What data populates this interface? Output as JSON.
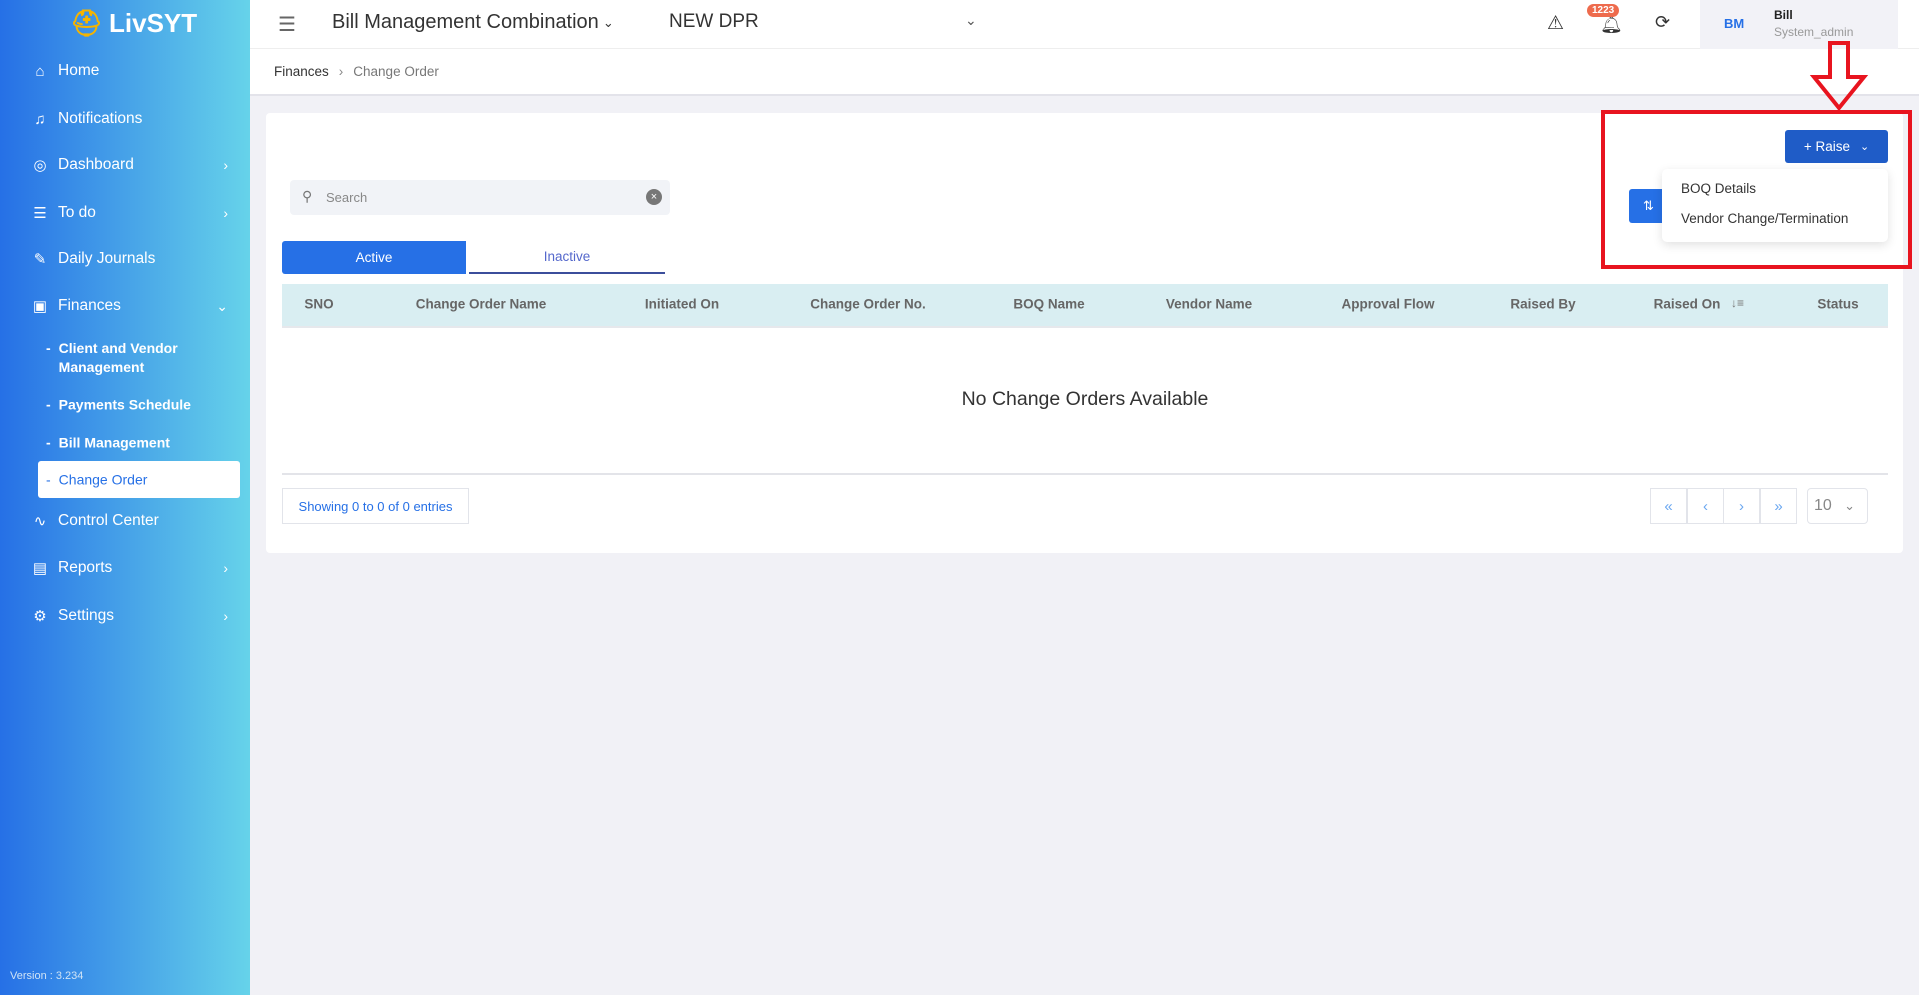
{
  "app": {
    "logo": "LivSYT",
    "version": "Version : 3.234"
  },
  "sidebar": {
    "items": [
      {
        "label": "Home",
        "icon": "home-icon",
        "glyph": "⌂"
      },
      {
        "label": "Notifications",
        "icon": "bell-icon",
        "glyph": "🔔"
      },
      {
        "label": "Dashboard",
        "icon": "gauge-icon",
        "glyph": "◎"
      },
      {
        "label": "To do",
        "icon": "list-icon",
        "glyph": "☰"
      },
      {
        "label": "Daily Journals",
        "icon": "pencil-icon",
        "glyph": "✎"
      },
      {
        "label": "Finances",
        "icon": "money-icon",
        "glyph": "▣"
      },
      {
        "label": "Control Center",
        "icon": "pulse-icon",
        "glyph": "∿"
      },
      {
        "label": "Reports",
        "icon": "report-icon",
        "glyph": "▤"
      },
      {
        "label": "Settings",
        "icon": "gear-icon",
        "glyph": "⚙"
      }
    ],
    "finances_sub": [
      "Client and Vendor Management",
      "Payments Schedule",
      "Bill Management",
      "Change Order"
    ]
  },
  "header": {
    "project": "Bill Management Combination",
    "dpr": "NEW DPR",
    "notification_count": "1223",
    "user_initials": "BM",
    "user_name": "Bill",
    "user_role": "System_admin"
  },
  "breadcrumb": [
    "Finances",
    "Change Order"
  ],
  "main": {
    "search_placeholder": "Search",
    "tabs": [
      "Active",
      "Inactive"
    ],
    "raise_label": "+ Raise",
    "raise_menu": [
      "BOQ Details",
      "Vendor Change/Termination"
    ],
    "columns": [
      "SNO",
      "Change Order Name",
      "Initiated On",
      "Change Order No.",
      "BOQ Name",
      "Vendor Name",
      "Approval Flow",
      "Raised By",
      "Raised On",
      "Status"
    ],
    "empty_message": "No Change Orders Available",
    "showing": "Showing 0 to 0 of 0 entries",
    "page_size": "10"
  },
  "colors": {
    "accent": "#2670e6",
    "raise": "#1f5cc7",
    "annotation": "#e8141f"
  }
}
